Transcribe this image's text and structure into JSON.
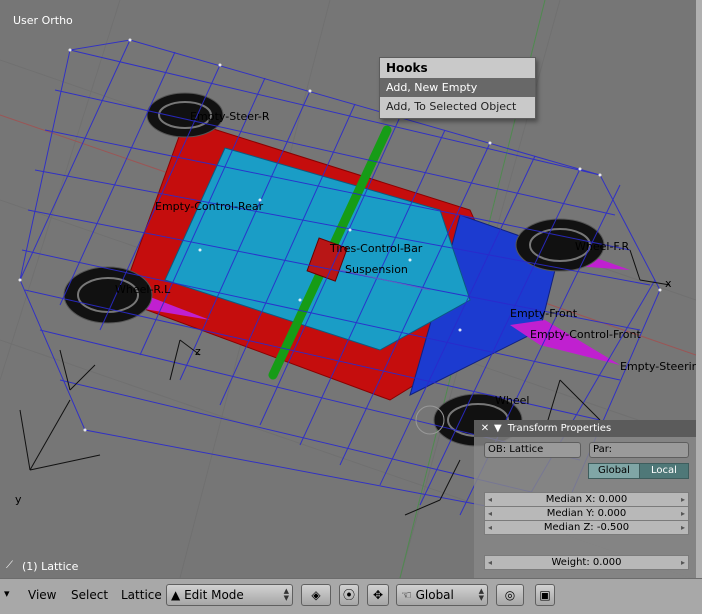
{
  "viewport": {
    "title": "User Ortho",
    "status": "(1) Lattice",
    "object_labels": {
      "rear_wheel_right": "Empty-Steer-R",
      "empty_control_rear": "Empty-Control-Rear",
      "tires_control_bar": "Tires-Control-Bar",
      "suspension": "Suspension",
      "wheel_front_right": "Wheel-F.R",
      "empty_front": "Empty-Front",
      "empty_control_front": "Empty-Control-Front",
      "empty_steering": "Empty-Steering",
      "wheel": "Wheel",
      "wheel_rear_left": "Wheel-R.L",
      "axis_x": "x",
      "axis_y": "y",
      "axis_z": "z"
    }
  },
  "hooks_menu": {
    "title": "Hooks",
    "items": [
      "Add, New Empty",
      "Add, To Selected Object"
    ],
    "active_index": 0
  },
  "transform_panel": {
    "title": "Transform Properties",
    "ob_field": "OB: Lattice",
    "par_field": "Par:",
    "toggle_global": "Global",
    "toggle_local": "Local",
    "median_x": "Median X: 0.000",
    "median_y": "Median Y: 0.000",
    "median_z": "Median Z: -0.500",
    "weight": "Weight: 0.000"
  },
  "header_bar": {
    "menus": [
      "View",
      "Select",
      "Lattice"
    ],
    "mode": "Edit Mode",
    "orientation": "Global"
  },
  "colors": {
    "lattice": "#2a2acc",
    "chassis_red": "#d40a0a",
    "chassis_cyan": "#1b9ec8",
    "bar_green": "#1aa51a",
    "magenta": "#c020d0"
  }
}
